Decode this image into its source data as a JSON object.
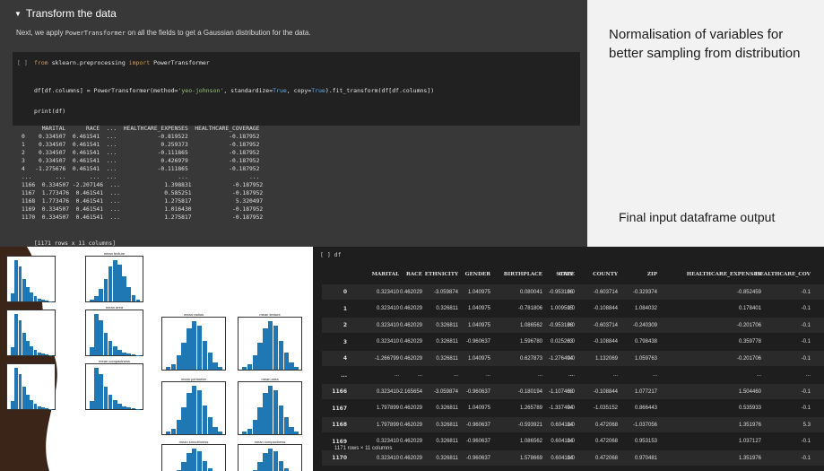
{
  "notebook": {
    "section_title": "Transform the data",
    "description_pre": "Next, we apply ",
    "description_code": "PowerTransformer",
    "description_post": " on all the fields to get a Gaussian distribution for the data.",
    "prompt": "[ ]",
    "code_line1_kw1": "from",
    "code_line1_mid": " sklearn.preprocessing ",
    "code_line1_kw2": "import",
    "code_line1_end": " PowerTransformer",
    "code_line2_a": "df[df.columns] = PowerTransformer(method=",
    "code_line2_str": "'yeo-johnson'",
    "code_line2_b": ", standardize=",
    "code_line2_true1": "True",
    "code_line2_c": ", copy=",
    "code_line2_true2": "True",
    "code_line2_d": ").fit_transform(df[df.columns])",
    "code_line3": "print(df)",
    "output_rows": [
      "      MARITAL      RACE  ...  HEALTHCARE_EXPENSES  HEALTHCARE_COVERAGE",
      "0    0.334507  0.461541  ...            -0.819522            -0.187952",
      "1    0.334507  0.461541  ...             0.259373            -0.187952",
      "2    0.334507  0.461541  ...            -0.111865            -0.187952",
      "3    0.334507  0.461541  ...             0.426979            -0.187952",
      "4   -1.275676  0.461541  ...            -0.111865            -0.187952",
      "...       ...       ...  ...                  ...                  ...",
      "1166  0.334507 -2.207146  ...             1.398831            -0.187952",
      "1167  1.773476  0.461541  ...             0.585251            -0.187952",
      "1168  1.773476  0.461541  ...             1.275817             5.320497",
      "1169  0.334507  0.461541  ...             1.016430            -0.187952",
      "1170  0.334507  0.461541  ...             1.275817            -0.187952"
    ],
    "output_shape": "[1171 rows x 11 columns]"
  },
  "slide": {
    "text1": "Normalisation of variables for better sampling from distribution",
    "text2": "Final input dataframe output"
  },
  "histograms": {
    "labels": [
      "mean texture",
      "mean area",
      "mean compactness",
      "mean radius",
      "mean texture",
      "mean perimeter",
      "mean area",
      "mean smoothness",
      "mean compactness"
    ],
    "bar_color": "#1f77b4"
  },
  "df_cell": {
    "prompt": "[ ]  df",
    "columns": [
      "",
      "MARITAL",
      "RACE",
      "ETHNICITY",
      "GENDER",
      "BIRTHPLACE",
      "CITY",
      "STATE",
      "COUNTY",
      "ZIP",
      "HEALTHCARE_EXPENSES",
      "HEALTHCARE_COV"
    ],
    "rows": [
      [
        "0",
        "0.323410",
        "0.462029",
        "-3.059874",
        "1.040975",
        "0.080041",
        "-0.953186",
        "0.0",
        "-0.603714",
        "-0.329374",
        "-0.852459",
        "-0.1"
      ],
      [
        "1",
        "0.323410",
        "0.462029",
        "0.326811",
        "1.040975",
        "-0.781806",
        "1.009515",
        "0.0",
        "-0.108844",
        "1.084032",
        "0.178401",
        "-0.1"
      ],
      [
        "2",
        "0.323410",
        "0.462029",
        "0.326811",
        "1.040975",
        "1.086562",
        "-0.953186",
        "0.0",
        "-0.603714",
        "-0.240309",
        "-0.201706",
        "-0.1"
      ],
      [
        "3",
        "0.323410",
        "0.462029",
        "0.326811",
        "-0.960637",
        "1.596780",
        "0.025263",
        "0.0",
        "-0.108844",
        "0.798438",
        "0.359778",
        "-0.1"
      ],
      [
        "4",
        "-1.266799",
        "0.462029",
        "0.326811",
        "1.040975",
        "0.627873",
        "-1.276494",
        "0.0",
        "1.132069",
        "1.059763",
        "-0.201706",
        "-0.1"
      ],
      [
        "...",
        "...",
        "...",
        "...",
        "...",
        "...",
        "...",
        "...",
        "...",
        "...",
        "...",
        "..."
      ],
      [
        "1166",
        "0.323410",
        "-2.165654",
        "-3.059874",
        "-0.960637",
        "-0.180194",
        "-1.107468",
        "0.0",
        "-0.108844",
        "1.077217",
        "1.504460",
        "-0.1"
      ],
      [
        "1167",
        "1.797899",
        "0.462029",
        "0.326811",
        "1.040975",
        "1.265789",
        "-1.337494",
        "0.0",
        "-1.035152",
        "0.866443",
        "0.535933",
        "-0.1"
      ],
      [
        "1168",
        "1.797899",
        "0.462029",
        "0.326811",
        "-0.960637",
        "-0.593921",
        "0.604114",
        "0.0",
        "0.472068",
        "-1.037056",
        "1.351976",
        "5.3"
      ],
      [
        "1169",
        "0.323410",
        "0.462029",
        "0.326811",
        "-0.960637",
        "1.086562",
        "0.604114",
        "0.0",
        "0.472068",
        "0.953153",
        "1.037127",
        "-0.1"
      ],
      [
        "1170",
        "0.323410",
        "0.462029",
        "0.326811",
        "-0.960637",
        "1.578669",
        "0.604114",
        "0.0",
        "0.472068",
        "0.970481",
        "1.351976",
        "-0.1"
      ]
    ],
    "footer": "1171 rows × 11 columns"
  }
}
